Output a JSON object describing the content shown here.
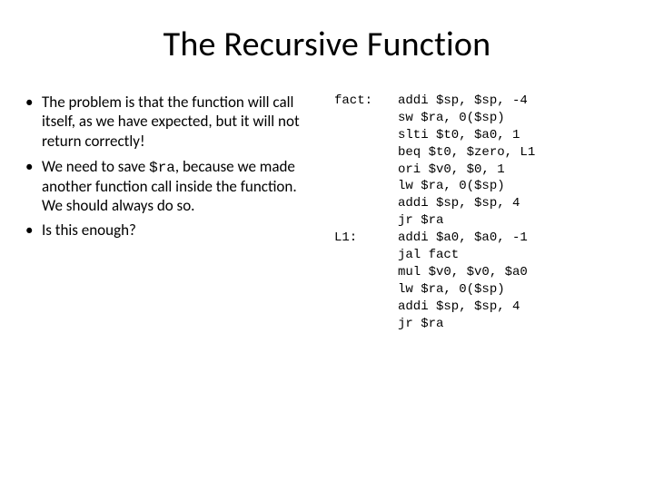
{
  "title": "The Recursive Function",
  "bullets": [
    {
      "pre": "The problem is that the function will call itself, as we have expected, but it will not return correctly!",
      "code": "",
      "post": ""
    },
    {
      "pre": "We need to save ",
      "code": "$ra",
      "post": ", because we made another function call inside the function. We should always do so."
    },
    {
      "pre": "Is this enough?",
      "code": "",
      "post": ""
    }
  ],
  "asm": {
    "labels": "fact:\n\n\n\n\n\n\n\nL1:",
    "code": "addi $sp, $sp, -4\nsw $ra, 0($sp)\nslti $t0, $a0, 1\nbeq $t0, $zero, L1\nori $v0, $0, 1\nlw $ra, 0($sp)\naddi $sp, $sp, 4\njr $ra\naddi $a0, $a0, -1\njal fact\nmul $v0, $v0, $a0\nlw $ra, 0($sp)\naddi $sp, $sp, 4\njr $ra"
  }
}
